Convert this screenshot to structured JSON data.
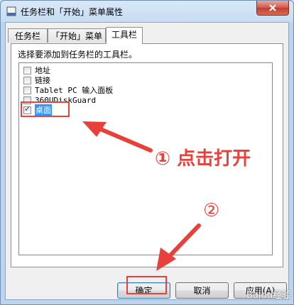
{
  "window": {
    "title": "任务栏和「开始」菜单属性"
  },
  "tabs": [
    {
      "label": "任务栏"
    },
    {
      "label": "「开始」菜单"
    },
    {
      "label": "工具栏"
    }
  ],
  "instruction": "选择要添加到任务栏的工具栏。",
  "toolbars": [
    {
      "label": "地址",
      "checked": false
    },
    {
      "label": "链接",
      "checked": false
    },
    {
      "label": "Tablet PC 输入面板",
      "checked": false
    },
    {
      "label": "360UDiskGuard",
      "checked": false
    },
    {
      "label": "桌面",
      "checked": true,
      "selected": true
    }
  ],
  "buttons": {
    "ok": "确定",
    "cancel": "取消",
    "apply": "应用(A)"
  },
  "annotations": {
    "step1": "① 点击打开",
    "step2": "②",
    "color": "#e8413c"
  },
  "watermark": "Baidu经验"
}
